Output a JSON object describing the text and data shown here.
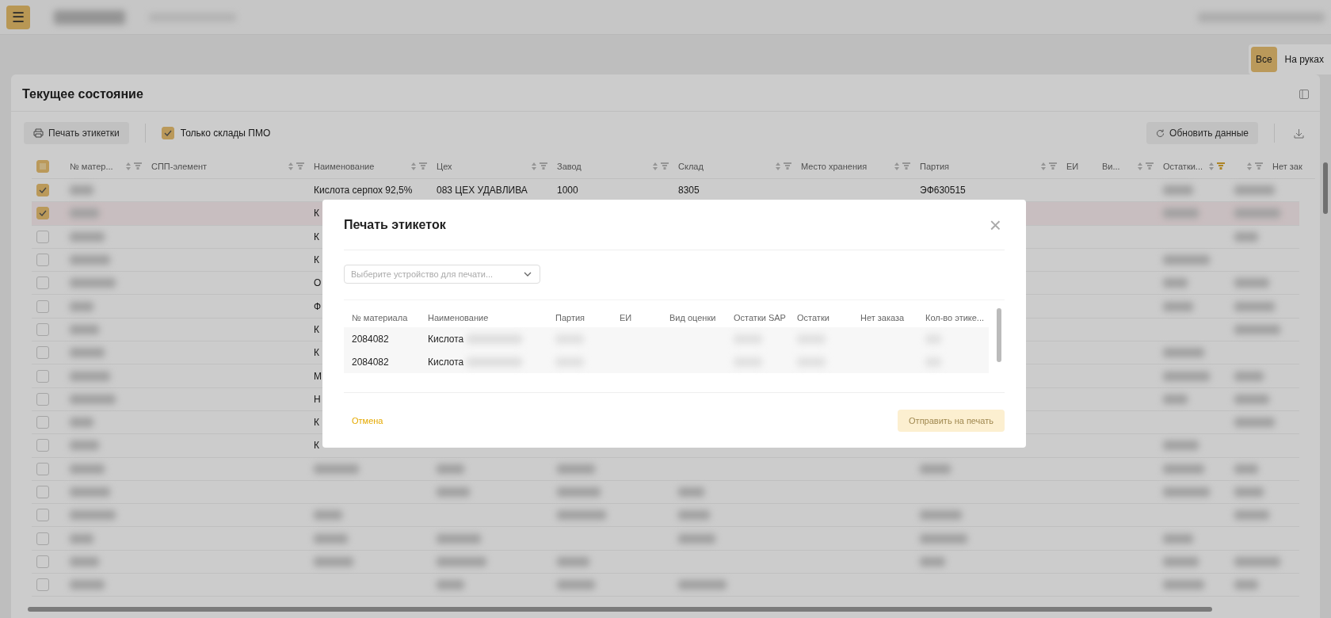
{
  "header": {
    "menu_button": "☰"
  },
  "view_toggle": [
    {
      "label": "Все",
      "selected": true
    },
    {
      "label": "На руках",
      "selected": false
    }
  ],
  "card": {
    "title": "Текущее состояние"
  },
  "toolbar": {
    "print_button": "Печать этикетки",
    "only_pmo": {
      "label": "Только склады ПМО",
      "checked": true
    },
    "refresh_button": "Обновить данные"
  },
  "table": {
    "indeterminate": true,
    "columns": [
      {
        "label": "№ матер...",
        "filter_active": false
      },
      {
        "label": "СПП-элемент",
        "filter_active": false
      },
      {
        "label": "Наименование",
        "filter_active": false
      },
      {
        "label": "Цех",
        "filter_active": false
      },
      {
        "label": "Завод",
        "filter_active": false
      },
      {
        "label": "Склад",
        "filter_active": false
      },
      {
        "label": "Место хранения",
        "filter_active": false
      },
      {
        "label": "Партия",
        "filter_active": false
      },
      {
        "label": "ЕИ",
        "kind": "plain"
      },
      {
        "label": "Ви...",
        "filter_active": false
      },
      {
        "label": "Остатки...",
        "filter_active": true
      },
      {
        "filter_active": false
      },
      {
        "label": "Нет зак",
        "kind": "plain"
      }
    ],
    "rows": [
      {
        "checked": true,
        "selected": false,
        "cells": {
          "name": "Кислота серпох 92,5%",
          "shop": "083 ЦЕХ УДАВЛИВА",
          "plant": "1000",
          "warehouse": "8305",
          "batch": "ЭФ630515"
        }
      },
      {
        "checked": true,
        "selected": true,
        "cells": {
          "name": "К"
        }
      },
      {
        "checked": false,
        "selected": false,
        "cells": {
          "name": "К"
        }
      },
      {
        "checked": false,
        "selected": false,
        "cells": {
          "name": "К"
        }
      },
      {
        "checked": false,
        "selected": false,
        "cells": {
          "name": "О"
        }
      },
      {
        "checked": false,
        "selected": false,
        "cells": {
          "name": "Ф"
        }
      },
      {
        "checked": false,
        "selected": false,
        "cells": {
          "name": "К"
        }
      },
      {
        "checked": false,
        "selected": false,
        "cells": {
          "name": "К"
        }
      },
      {
        "checked": false,
        "selected": false,
        "cells": {
          "name": "М"
        }
      },
      {
        "checked": false,
        "selected": false,
        "cells": {
          "name": "Н"
        }
      },
      {
        "checked": false,
        "selected": false,
        "cells": {
          "name": "К"
        }
      },
      {
        "checked": false,
        "selected": false,
        "cells": {
          "name": "К"
        }
      },
      {
        "checked": false,
        "selected": false,
        "cells": {}
      },
      {
        "checked": false,
        "selected": false,
        "cells": {}
      },
      {
        "checked": false,
        "selected": false,
        "cells": {}
      },
      {
        "checked": false,
        "selected": false,
        "cells": {}
      },
      {
        "checked": false,
        "selected": false,
        "cells": {}
      },
      {
        "checked": false,
        "selected": false,
        "cells": {}
      }
    ]
  },
  "dialog": {
    "title": "Печать этикеток",
    "close": "×",
    "device_select": {
      "placeholder": "Выберите устройство для печати..."
    },
    "columns": [
      "№ материала",
      "Наименование",
      "Партия",
      "ЕИ",
      "Вид оценки",
      "Остатки SAP",
      "Остатки",
      "Нет заказа",
      "Кол-во этике..."
    ],
    "rows": [
      {
        "material": "2084082",
        "name": "Кислота"
      },
      {
        "material": "2084082",
        "name": "Кислота"
      }
    ],
    "cancel_button": "Отмена",
    "send_button": {
      "label": "Отправить на печать",
      "disabled": true
    }
  }
}
